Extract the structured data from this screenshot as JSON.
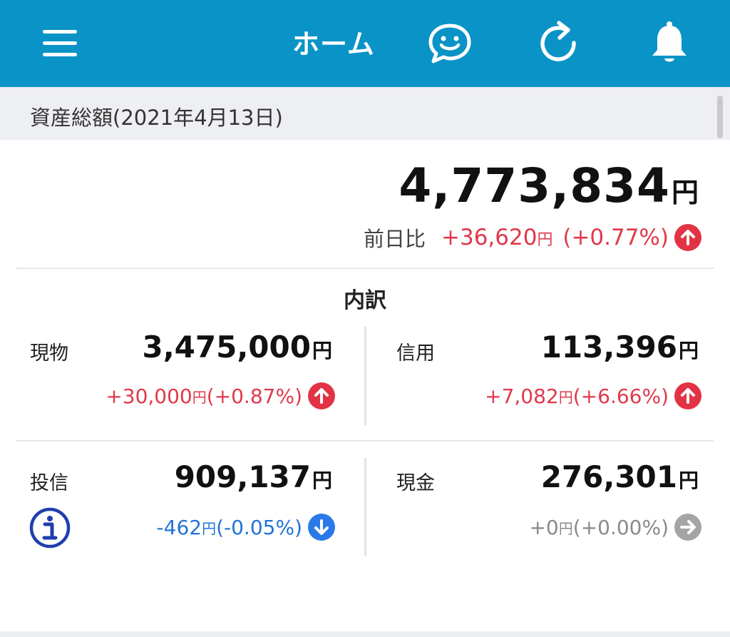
{
  "header": {
    "title": "ホーム",
    "menu_icon": "hamburger-menu-icon",
    "chat_icon": "chat-bubble-smile-icon",
    "refresh_icon": "refresh-icon",
    "bell_icon": "notification-bell-icon",
    "background_color": "#0a93c6"
  },
  "summary": {
    "section_label": "資産総額(2021年4月13日)",
    "total_amount": "4,773,834",
    "total_unit": "円",
    "change_label": "前日比",
    "change_amount": "+36,620",
    "change_unit": "円",
    "change_percent": "(+0.77%)",
    "change_direction": "up-arrow-icon"
  },
  "breakdown": {
    "title": "内訳",
    "items": [
      {
        "label": "現物",
        "amount": "3,475,000",
        "unit": "円",
        "change_amount": "+30,000",
        "change_unit": "円",
        "change_percent": "(+0.87%)",
        "direction": "up"
      },
      {
        "label": "信用",
        "amount": "113,396",
        "unit": "円",
        "change_amount": "+7,082",
        "change_unit": "円",
        "change_percent": "(+6.66%)",
        "direction": "up"
      },
      {
        "label": "投信",
        "amount": "909,137",
        "unit": "円",
        "change_amount": "-462",
        "change_unit": "円",
        "change_percent": "(-0.05%)",
        "direction": "down"
      },
      {
        "label": "現金",
        "amount": "276,301",
        "unit": "円",
        "change_amount": "+0",
        "change_unit": "円",
        "change_percent": "(+0.00%)",
        "direction": "flat"
      }
    ],
    "info_icon": "info-circle-icon"
  },
  "colors": {
    "positive": "#e0394b",
    "negative": "#2273d6",
    "neutral": "#8a8a8a"
  }
}
